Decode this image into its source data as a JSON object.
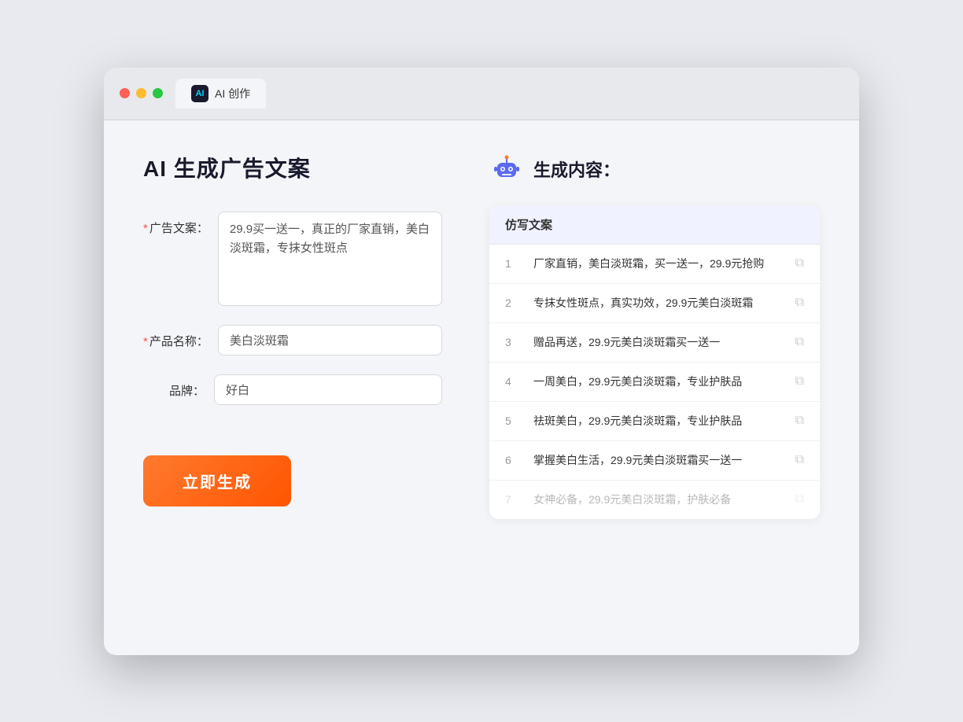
{
  "browser": {
    "tab_label": "AI 创作",
    "tab_icon": "AI"
  },
  "page": {
    "title": "AI 生成广告文案",
    "form": {
      "ad_copy_label": "广告文案：",
      "ad_copy_required": "＊",
      "ad_copy_value": "29.9买一送一，真正的厂家直销，美白淡斑霜，专抹女性斑点",
      "product_name_label": "产品名称：",
      "product_name_required": "＊",
      "product_name_value": "美白淡斑霜",
      "brand_label": "品牌：",
      "brand_value": "好白",
      "generate_button": "立即生成"
    },
    "results": {
      "header_icon": "robot",
      "header_title": "生成内容：",
      "column_label": "仿写文案",
      "items": [
        {
          "num": "1",
          "text": "厂家直销，美白淡斑霜，买一送一，29.9元抢购",
          "faded": false
        },
        {
          "num": "2",
          "text": "专抹女性斑点，真实功效，29.9元美白淡斑霜",
          "faded": false
        },
        {
          "num": "3",
          "text": "赠品再送，29.9元美白淡斑霜买一送一",
          "faded": false
        },
        {
          "num": "4",
          "text": "一周美白，29.9元美白淡斑霜，专业护肤品",
          "faded": false
        },
        {
          "num": "5",
          "text": "祛斑美白，29.9元美白淡斑霜，专业护肤品",
          "faded": false
        },
        {
          "num": "6",
          "text": "掌握美白生活，29.9元美白淡斑霜买一送一",
          "faded": false
        },
        {
          "num": "7",
          "text": "女神必备，29.9元美白淡斑霜，护肤必备",
          "faded": true
        }
      ]
    }
  }
}
